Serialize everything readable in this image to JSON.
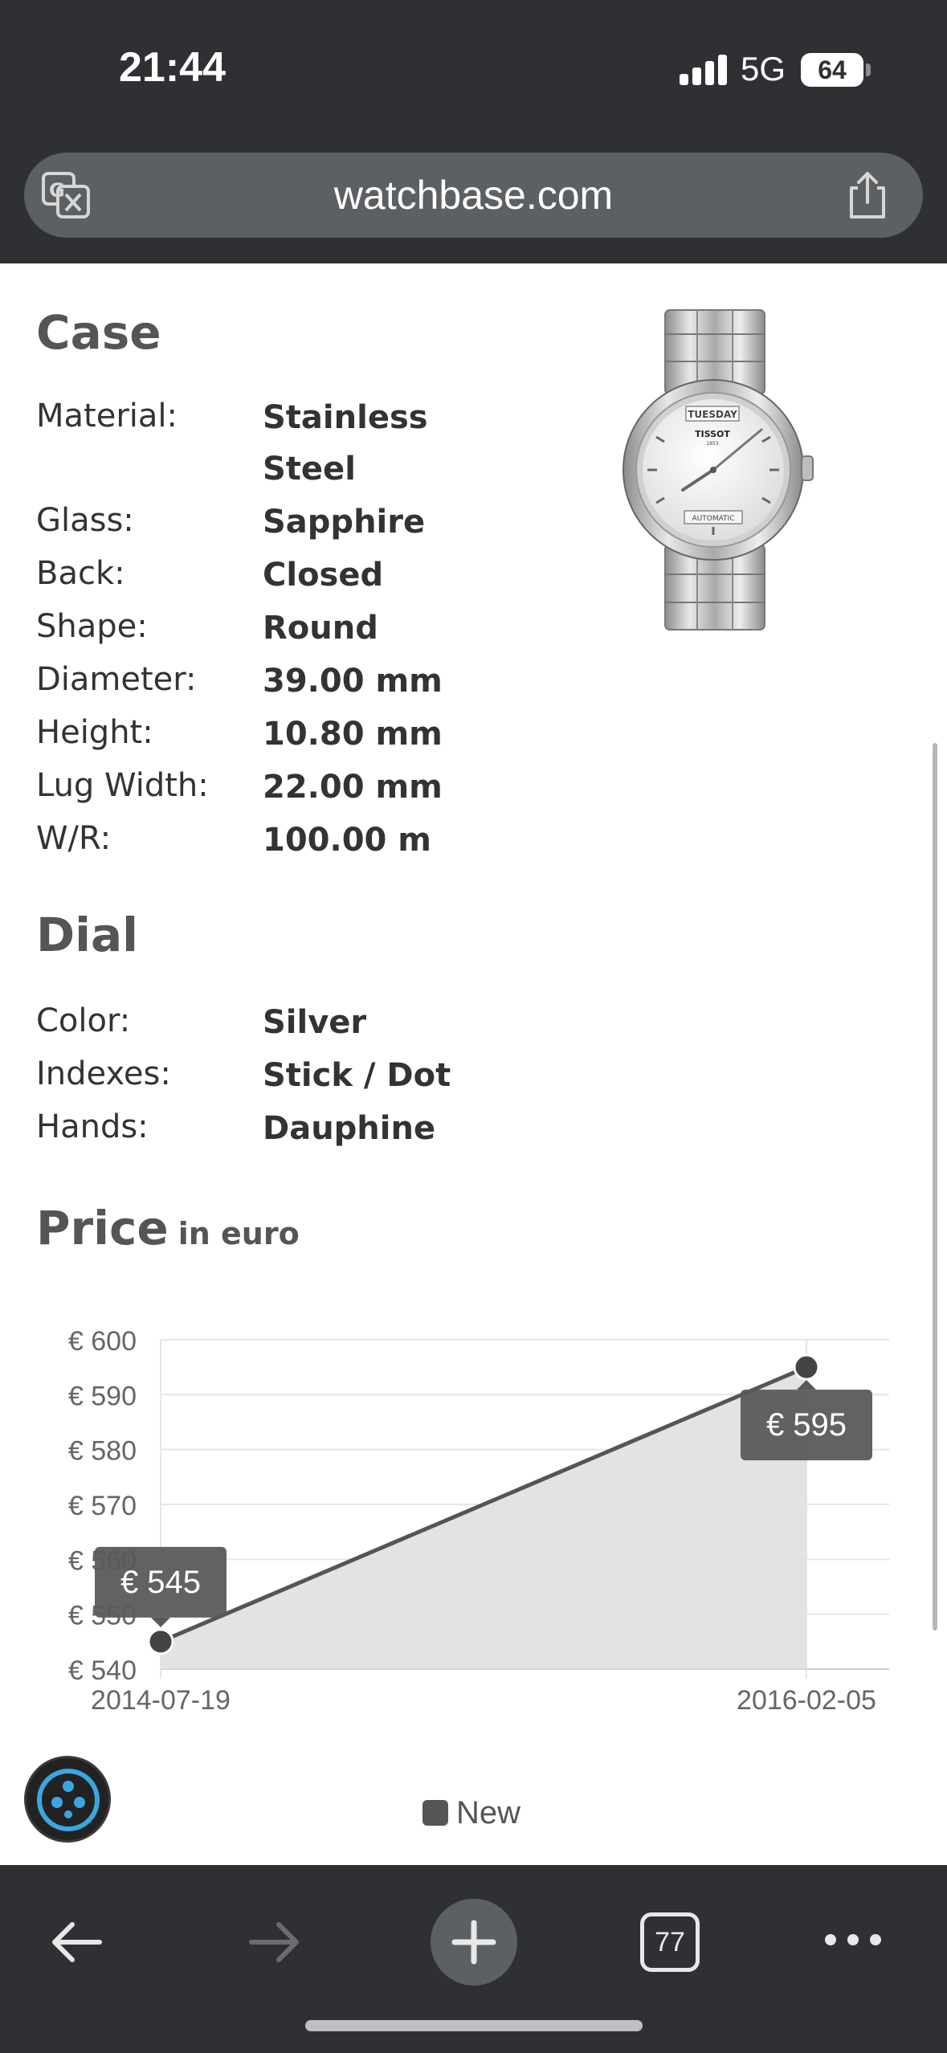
{
  "status_bar": {
    "time": "21:44",
    "network": "5G",
    "battery": "64"
  },
  "address_bar": {
    "url": "watchbase.com"
  },
  "case": {
    "title": "Case",
    "rows": [
      {
        "label": "Material:",
        "value": "Stainless Steel"
      },
      {
        "label": "Glass:",
        "value": "Sapphire"
      },
      {
        "label": "Back:",
        "value": "Closed"
      },
      {
        "label": "Shape:",
        "value": "Round"
      },
      {
        "label": "Diameter:",
        "value": "39.00 mm"
      },
      {
        "label": "Height:",
        "value": "10.80 mm"
      },
      {
        "label": "Lug Width:",
        "value": "22.00 mm"
      },
      {
        "label": "W/R:",
        "value": "100.00 m"
      }
    ]
  },
  "dial": {
    "title": "Dial",
    "rows": [
      {
        "label": "Color:",
        "value": "Silver"
      },
      {
        "label": "Indexes:",
        "value": "Stick / Dot"
      },
      {
        "label": "Hands:",
        "value": "Dauphine"
      }
    ]
  },
  "price": {
    "title": "Price",
    "subtitle": "in euro"
  },
  "chart_data": {
    "type": "area",
    "x": [
      "2014-07-19",
      "2016-02-05"
    ],
    "series": [
      {
        "name": "New",
        "values": [
          545,
          595
        ]
      }
    ],
    "ylim": [
      540,
      600
    ],
    "y_ticks": [
      600,
      590,
      580,
      570,
      560,
      550,
      540
    ],
    "y_tick_labels": [
      "€ 600",
      "€ 590",
      "€ 580",
      "€ 570",
      "€ 560",
      "€ 550",
      "€ 540"
    ],
    "data_labels": [
      "€ 545",
      "€ 595"
    ],
    "grid": true,
    "legend_position": "bottom",
    "colors": {
      "line": "#555555",
      "fill": "#e0e0e0",
      "grid": "#e6e6e6",
      "tooltip": "#5a5a5a"
    }
  },
  "bottom_toolbar": {
    "tab_count": "77"
  },
  "icons": {
    "translate": "translate-icon",
    "share": "share-icon",
    "back": "back-arrow-icon",
    "forward": "forward-arrow-icon",
    "new_tab": "plus-icon",
    "tabs": "tabs-icon",
    "more": "more-icon",
    "helper": "watch-helper-icon"
  }
}
